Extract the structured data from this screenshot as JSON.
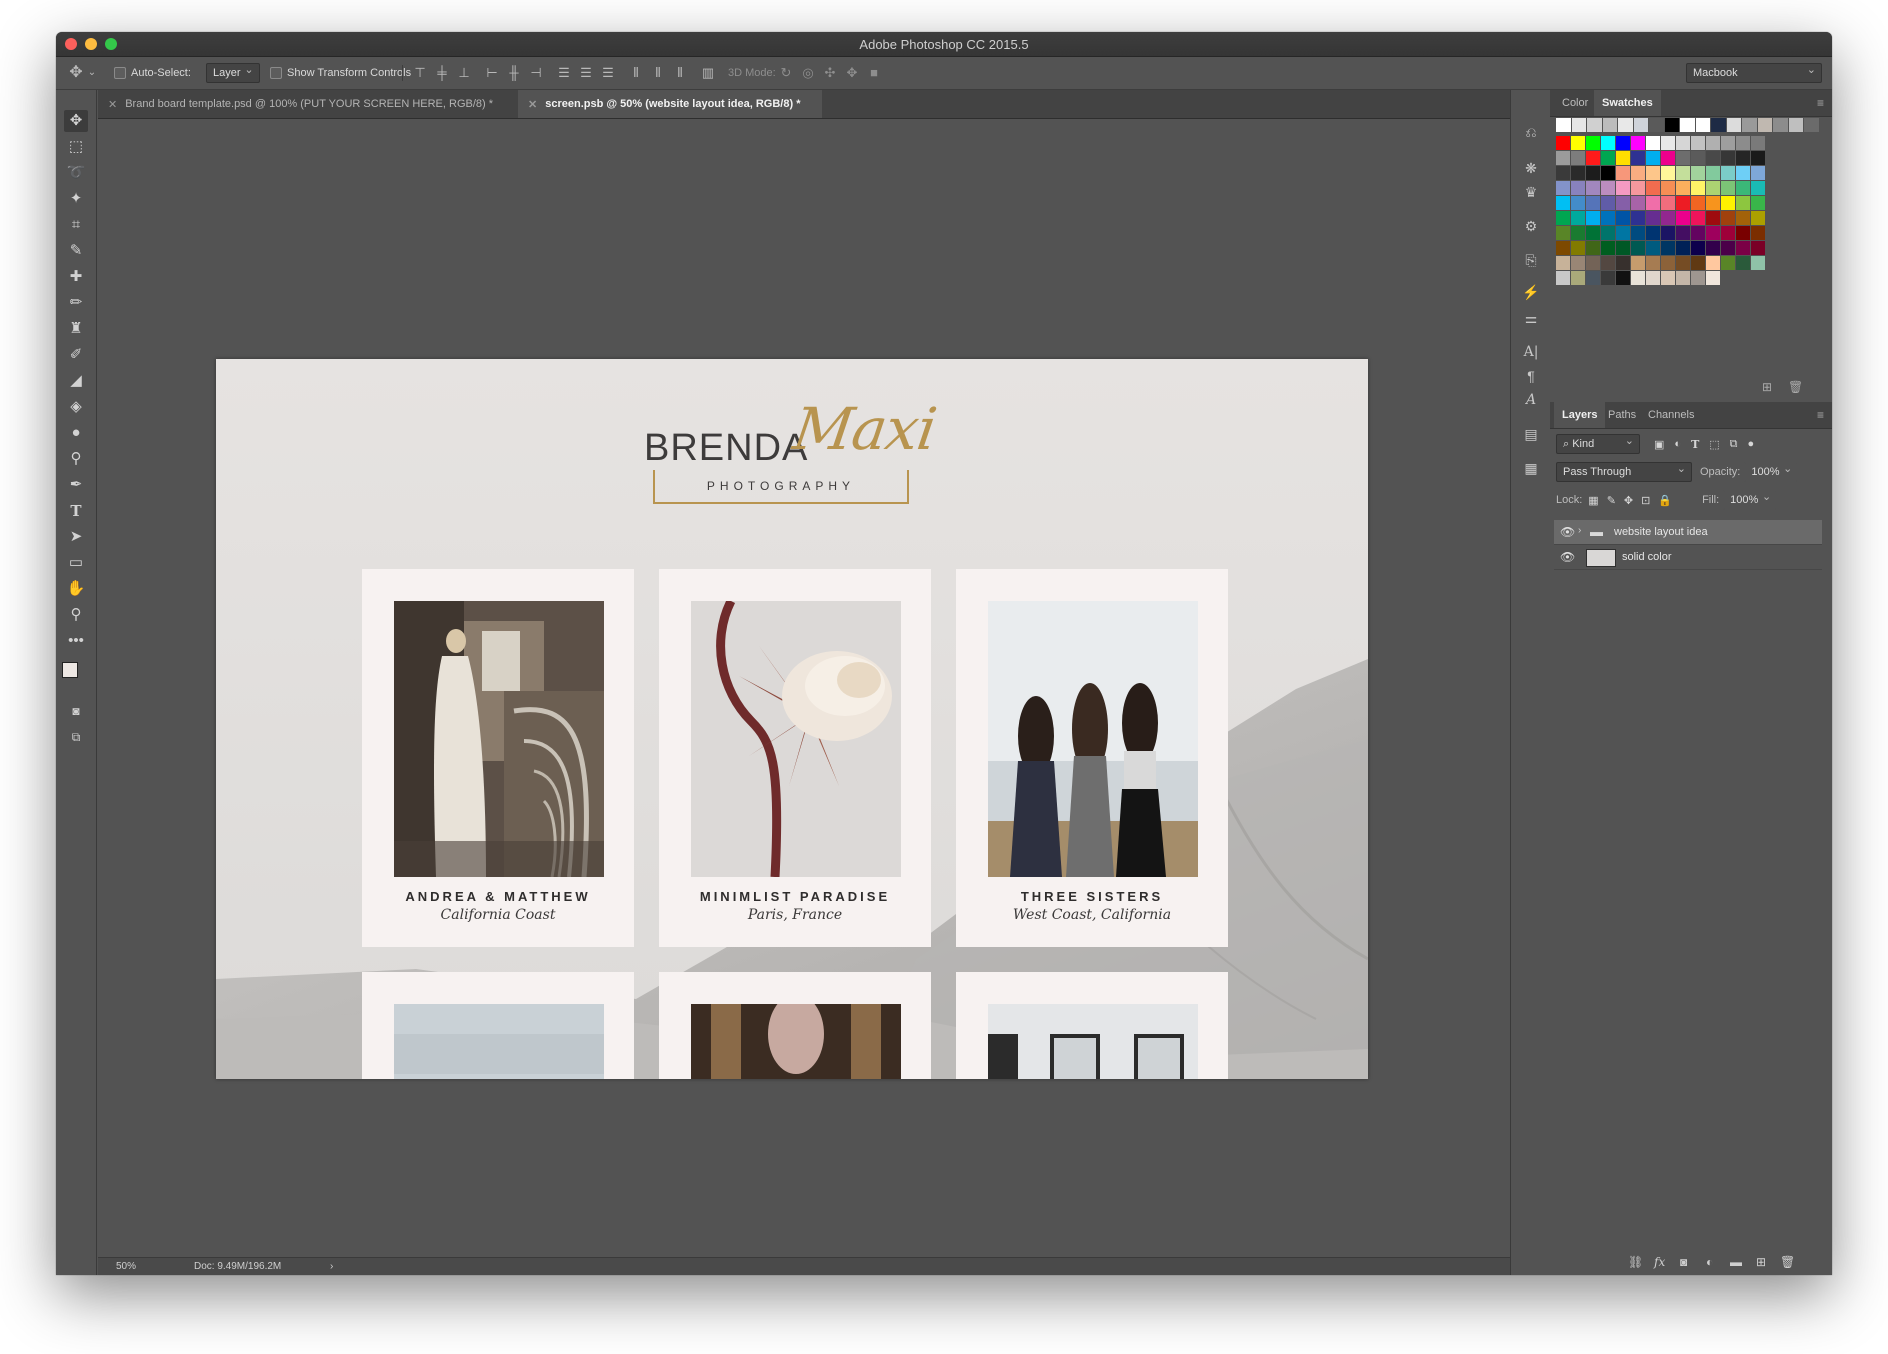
{
  "window": {
    "title": "Adobe Photoshop CC 2015.5",
    "traffic_lights": [
      "#fc605c",
      "#fdbc40",
      "#34c84a"
    ]
  },
  "options_bar": {
    "auto_select_label": "Auto-Select:",
    "auto_select_value": "Layer",
    "show_transform_label": "Show Transform Controls",
    "mode_3d_label": "3D Mode:",
    "workspace_value": "Macbook"
  },
  "doc_tabs": [
    {
      "label": "Brand board template.psd @ 100% (PUT YOUR SCREEN HERE, RGB/8) *",
      "active": false
    },
    {
      "label": "screen.psb @ 50% (website layout idea, RGB/8) *",
      "active": true
    }
  ],
  "document": {
    "logo_name": "BRENDA",
    "logo_script": "Maxi",
    "logo_sub": "PHOTOGRAPHY",
    "accent_color": "#b8944f",
    "cards": [
      {
        "title": "ANDREA & MATTHEW",
        "subtitle": "California Coast"
      },
      {
        "title": "MINIMLIST PARADISE",
        "subtitle": "Paris, France"
      },
      {
        "title": "THREE SISTERS",
        "subtitle": "West Coast, California"
      }
    ]
  },
  "status_bar": {
    "zoom": "50%",
    "doc_size": "Doc: 9.49M/196.2M"
  },
  "color_panel": {
    "tabs": [
      "Color",
      "Swatches"
    ],
    "active_tab": "Swatches"
  },
  "layers_panel": {
    "tabs": [
      "Layers",
      "Paths",
      "Channels"
    ],
    "active_tab": "Layers",
    "filter_kind": "Kind",
    "blend_mode": "Pass Through",
    "opacity_label": "Opacity:",
    "opacity_value": "100%",
    "lock_label": "Lock:",
    "fill_label": "Fill:",
    "fill_value": "100%",
    "layers": [
      {
        "name": "website layout idea",
        "type": "group",
        "selected": true
      },
      {
        "name": "solid color",
        "type": "fill",
        "selected": false
      }
    ]
  }
}
